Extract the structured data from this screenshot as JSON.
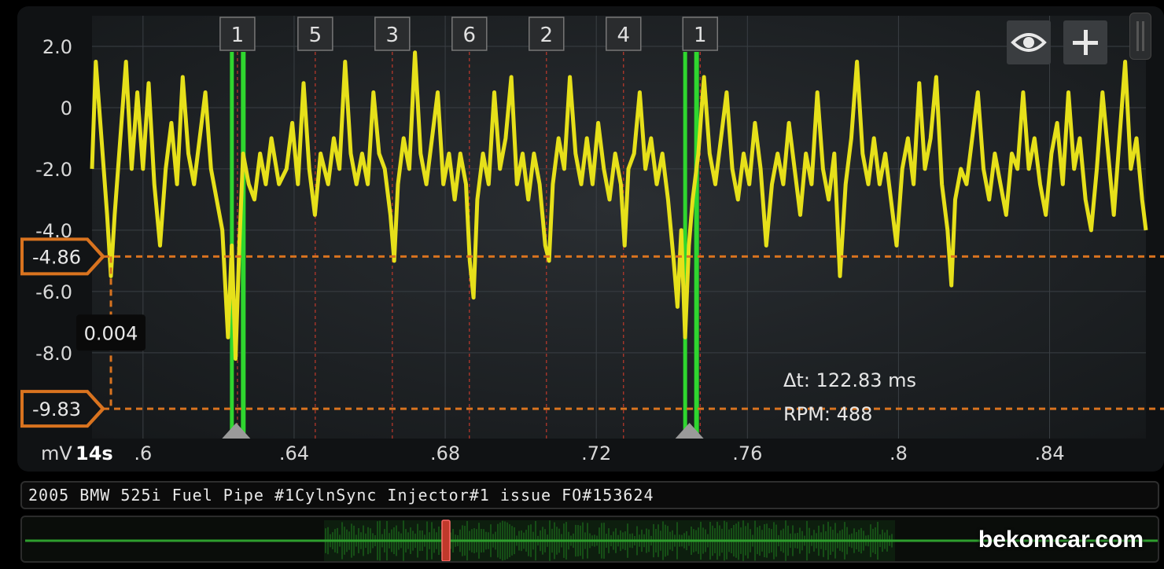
{
  "chart_data": {
    "type": "line",
    "y_unit": "mV",
    "x_scale_label": "14s",
    "ylim": [
      -10.8,
      3.0
    ],
    "xlim": [
      0.5865,
      0.8655
    ],
    "y_tick_labels": [
      "2.0",
      "0",
      "-2.0",
      "-4.0",
      "-6.0",
      "-8.0"
    ],
    "y_ticks": [
      2.0,
      0,
      -2.0,
      -4.0,
      -6.0,
      -8.0
    ],
    "x_tick_labels": [
      ".6",
      ".64",
      ".68",
      ".72",
      ".76",
      ".8",
      ".84"
    ],
    "x_ticks": [
      0.6,
      0.64,
      0.68,
      0.72,
      0.76,
      0.8,
      0.84
    ],
    "grid": true,
    "series": [
      {
        "color": "#e6e01a",
        "points": [
          [
            0.5865,
            -2.0
          ],
          [
            0.5875,
            1.5
          ],
          [
            0.589,
            -1.0
          ],
          [
            0.5905,
            -3.5
          ],
          [
            0.5915,
            -5.5
          ],
          [
            0.5925,
            -3.5
          ],
          [
            0.594,
            -1.0
          ],
          [
            0.5955,
            1.5
          ],
          [
            0.597,
            -2.0
          ],
          [
            0.5985,
            0.5
          ],
          [
            0.6,
            -2.0
          ],
          [
            0.6015,
            0.8
          ],
          [
            0.603,
            -2.5
          ],
          [
            0.6045,
            -4.5
          ],
          [
            0.606,
            -2.0
          ],
          [
            0.6075,
            -0.5
          ],
          [
            0.609,
            -2.5
          ],
          [
            0.6105,
            1.0
          ],
          [
            0.612,
            -1.5
          ],
          [
            0.6135,
            -2.5
          ],
          [
            0.615,
            -1.0
          ],
          [
            0.6165,
            0.5
          ],
          [
            0.618,
            -2.0
          ],
          [
            0.6195,
            -3.0
          ],
          [
            0.621,
            -4.0
          ],
          [
            0.6225,
            -7.5
          ],
          [
            0.6235,
            -4.5
          ],
          [
            0.6245,
            -8.2
          ],
          [
            0.6255,
            -4.5
          ],
          [
            0.6265,
            -1.5
          ],
          [
            0.628,
            -2.5
          ],
          [
            0.6295,
            -3.0
          ],
          [
            0.631,
            -1.5
          ],
          [
            0.6325,
            -2.5
          ],
          [
            0.634,
            -1.0
          ],
          [
            0.636,
            -2.5
          ],
          [
            0.638,
            -2.0
          ],
          [
            0.6395,
            -0.5
          ],
          [
            0.641,
            -2.5
          ],
          [
            0.6425,
            0.8
          ],
          [
            0.644,
            -2.0
          ],
          [
            0.6455,
            -3.5
          ],
          [
            0.647,
            -1.5
          ],
          [
            0.649,
            -2.5
          ],
          [
            0.6505,
            -1.0
          ],
          [
            0.652,
            -2.0
          ],
          [
            0.6535,
            1.5
          ],
          [
            0.655,
            -1.5
          ],
          [
            0.6565,
            -2.5
          ],
          [
            0.658,
            -1.5
          ],
          [
            0.6595,
            -2.5
          ],
          [
            0.661,
            0.5
          ],
          [
            0.6625,
            -1.5
          ],
          [
            0.664,
            -2.0
          ],
          [
            0.6655,
            -3.5
          ],
          [
            0.6665,
            -5.0
          ],
          [
            0.6675,
            -2.5
          ],
          [
            0.669,
            -1.0
          ],
          [
            0.6705,
            -2.0
          ],
          [
            0.672,
            1.8
          ],
          [
            0.6735,
            -1.5
          ],
          [
            0.675,
            -2.5
          ],
          [
            0.6765,
            -1.0
          ],
          [
            0.678,
            0.5
          ],
          [
            0.6795,
            -2.5
          ],
          [
            0.681,
            -1.5
          ],
          [
            0.6825,
            -3.0
          ],
          [
            0.684,
            -1.5
          ],
          [
            0.6855,
            -2.5
          ],
          [
            0.6865,
            -5.0
          ],
          [
            0.6875,
            -6.2
          ],
          [
            0.6885,
            -3.0
          ],
          [
            0.69,
            -1.5
          ],
          [
            0.6915,
            -2.5
          ],
          [
            0.693,
            0.5
          ],
          [
            0.6945,
            -2.0
          ],
          [
            0.696,
            -1.0
          ],
          [
            0.6975,
            1.0
          ],
          [
            0.699,
            -2.5
          ],
          [
            0.7005,
            -1.5
          ],
          [
            0.702,
            -3.0
          ],
          [
            0.7035,
            -1.5
          ],
          [
            0.705,
            -2.5
          ],
          [
            0.7065,
            -4.5
          ],
          [
            0.7075,
            -5.0
          ],
          [
            0.7085,
            -2.5
          ],
          [
            0.71,
            -1.0
          ],
          [
            0.7115,
            -2.0
          ],
          [
            0.713,
            1.0
          ],
          [
            0.7145,
            -1.5
          ],
          [
            0.716,
            -2.5
          ],
          [
            0.7175,
            -1.0
          ],
          [
            0.719,
            -2.5
          ],
          [
            0.7205,
            -0.5
          ],
          [
            0.722,
            -2.0
          ],
          [
            0.7235,
            -3.0
          ],
          [
            0.725,
            -1.5
          ],
          [
            0.7265,
            -2.5
          ],
          [
            0.7275,
            -4.5
          ],
          [
            0.7285,
            -2.0
          ],
          [
            0.73,
            -1.5
          ],
          [
            0.7315,
            0.5
          ],
          [
            0.733,
            -2.0
          ],
          [
            0.7345,
            -1.0
          ],
          [
            0.736,
            -2.5
          ],
          [
            0.7375,
            -1.5
          ],
          [
            0.739,
            -3.0
          ],
          [
            0.7405,
            -5.0
          ],
          [
            0.7415,
            -6.5
          ],
          [
            0.7425,
            -4.0
          ],
          [
            0.7435,
            -7.5
          ],
          [
            0.7445,
            -4.5
          ],
          [
            0.7455,
            -3.0
          ],
          [
            0.747,
            -1.5
          ],
          [
            0.7485,
            1.0
          ],
          [
            0.75,
            -1.5
          ],
          [
            0.7515,
            -2.5
          ],
          [
            0.753,
            -1.0
          ],
          [
            0.7545,
            0.5
          ],
          [
            0.756,
            -2.0
          ],
          [
            0.7575,
            -3.0
          ],
          [
            0.759,
            -1.5
          ],
          [
            0.7605,
            -2.5
          ],
          [
            0.762,
            -0.5
          ],
          [
            0.7635,
            -2.0
          ],
          [
            0.765,
            -4.5
          ],
          [
            0.7665,
            -2.5
          ],
          [
            0.768,
            -1.5
          ],
          [
            0.7695,
            -2.5
          ],
          [
            0.771,
            -0.5
          ],
          [
            0.7725,
            -2.0
          ],
          [
            0.774,
            -3.5
          ],
          [
            0.7755,
            -1.5
          ],
          [
            0.777,
            -2.5
          ],
          [
            0.7785,
            0.5
          ],
          [
            0.78,
            -2.0
          ],
          [
            0.7815,
            -3.0
          ],
          [
            0.783,
            -1.5
          ],
          [
            0.7845,
            -5.5
          ],
          [
            0.786,
            -2.5
          ],
          [
            0.7875,
            -1.0
          ],
          [
            0.789,
            1.5
          ],
          [
            0.7905,
            -1.5
          ],
          [
            0.792,
            -2.5
          ],
          [
            0.7935,
            -1.0
          ],
          [
            0.795,
            -2.5
          ],
          [
            0.7965,
            -1.5
          ],
          [
            0.798,
            -3.0
          ],
          [
            0.7995,
            -4.5
          ],
          [
            0.801,
            -2.0
          ],
          [
            0.8025,
            -1.0
          ],
          [
            0.804,
            -2.5
          ],
          [
            0.8055,
            0.8
          ],
          [
            0.807,
            -2.0
          ],
          [
            0.8085,
            -1.0
          ],
          [
            0.81,
            1.0
          ],
          [
            0.8115,
            -2.5
          ],
          [
            0.813,
            -4.0
          ],
          [
            0.814,
            -5.8
          ],
          [
            0.815,
            -3.0
          ],
          [
            0.8165,
            -2.0
          ],
          [
            0.818,
            -2.5
          ],
          [
            0.8195,
            -1.0
          ],
          [
            0.821,
            0.5
          ],
          [
            0.8225,
            -2.0
          ],
          [
            0.824,
            -3.0
          ],
          [
            0.8255,
            -1.5
          ],
          [
            0.827,
            -2.5
          ],
          [
            0.8285,
            -3.5
          ],
          [
            0.83,
            -1.5
          ],
          [
            0.8315,
            -2.0
          ],
          [
            0.833,
            0.5
          ],
          [
            0.8345,
            -2.0
          ],
          [
            0.836,
            -1.0
          ],
          [
            0.8375,
            -2.5
          ],
          [
            0.839,
            -3.5
          ],
          [
            0.8405,
            -1.5
          ],
          [
            0.842,
            -0.5
          ],
          [
            0.8435,
            -2.5
          ],
          [
            0.845,
            0.5
          ],
          [
            0.8465,
            -2.0
          ],
          [
            0.848,
            -1.0
          ],
          [
            0.8495,
            -3.0
          ],
          [
            0.851,
            -4.0
          ],
          [
            0.8525,
            -2.0
          ],
          [
            0.854,
            0.5
          ],
          [
            0.8555,
            -1.5
          ],
          [
            0.857,
            -3.5
          ],
          [
            0.8585,
            -1.0
          ],
          [
            0.86,
            1.5
          ],
          [
            0.8615,
            -2.0
          ],
          [
            0.863,
            -1.0
          ],
          [
            0.8645,
            -3.0
          ],
          [
            0.8655,
            -4.0
          ]
        ]
      }
    ],
    "cursors": {
      "horizontal": [
        {
          "value": -4.86,
          "label": "-4.86"
        },
        {
          "value": -9.83,
          "label": "-9.83"
        }
      ],
      "vertical_x": [
        0.6255,
        0.7455
      ],
      "delta_label": "0.004",
      "delta_t_label": "Δt: 122.83 ms",
      "rpm_label": "RPM: 488",
      "delta_marker_x": 0.5915
    },
    "cylinder_markers": [
      {
        "label": "1",
        "x": 0.625
      },
      {
        "label": "5",
        "x": 0.6456
      },
      {
        "label": "3",
        "x": 0.666
      },
      {
        "label": "6",
        "x": 0.6864
      },
      {
        "label": "2",
        "x": 0.7068
      },
      {
        "label": "4",
        "x": 0.7272
      },
      {
        "label": "1",
        "x": 0.7475
      }
    ],
    "title": ""
  },
  "caption": "2005 BMW 525i Fuel Pipe #1CylnSync Injector#1 issue FO#153624",
  "watermark": "bekomcar.com",
  "icons": {
    "view": "eye-icon",
    "add": "plus-icon",
    "drag": "grip-handle-icon"
  },
  "colors": {
    "trace": "#e6e01a",
    "cursor": "#d9731f",
    "sync": "#2ecc40",
    "cyl_line": "#c0392b",
    "grid": "#3a3f44",
    "bg": "#1b1e21"
  }
}
